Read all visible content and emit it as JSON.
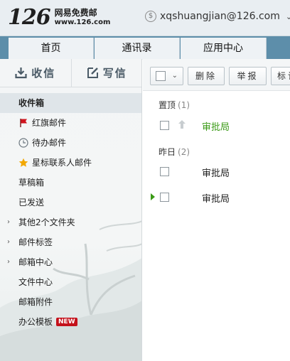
{
  "header": {
    "logo_number": "126",
    "logo_name": "网易免费邮",
    "logo_url": "www.126.com",
    "account_email": "xqshuangjian@126.com",
    "coin_symbol": "$",
    "caret": "⌄"
  },
  "tabs": [
    {
      "label": "首页"
    },
    {
      "label": "通讯录"
    },
    {
      "label": "应用中心"
    }
  ],
  "sidebar": {
    "receive_label": "收信",
    "compose_label": "写信",
    "folders": [
      {
        "label": "收件箱"
      },
      {
        "label": "红旗邮件"
      },
      {
        "label": "待办邮件"
      },
      {
        "label": "星标联系人邮件"
      },
      {
        "label": "草稿箱"
      },
      {
        "label": "已发送"
      },
      {
        "label": "其他2个文件夹"
      },
      {
        "label": "邮件标签"
      },
      {
        "label": "邮箱中心"
      },
      {
        "label": "文件中心"
      },
      {
        "label": "邮箱附件"
      },
      {
        "label": "办公模板"
      }
    ],
    "new_badge": "NEW",
    "expander_glyph": "›"
  },
  "toolbar": {
    "delete_label": "删除",
    "report_label": "举报",
    "mark_label": "标记",
    "caret": "⌄"
  },
  "mail_groups": [
    {
      "label": "置顶",
      "count": "(1)"
    },
    {
      "label": "昨日",
      "count": "(2)"
    }
  ],
  "mails": [
    {
      "sender": "审批局",
      "unread": true,
      "pinned": true
    },
    {
      "sender": "审批局",
      "unread": false
    },
    {
      "sender": "审批局",
      "unread": false,
      "current": true
    }
  ],
  "colors": {
    "tab_bar": "#5d8eaa",
    "unread_sender": "#3a9a16",
    "flag": "#d0141e",
    "star": "#f2a800",
    "new_badge": "#c4111b"
  },
  "icons": [
    "coin-icon",
    "inbox-download-icon",
    "compose-pen-icon",
    "red-flag-icon",
    "clock-icon",
    "star-icon",
    "pin-arrow-icon"
  ]
}
